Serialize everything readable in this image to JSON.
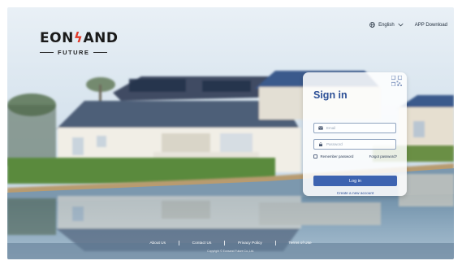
{
  "brand": {
    "logo_left": "EON",
    "logo_right": "AND",
    "tagline": "FUTURE"
  },
  "topbar": {
    "language": "English",
    "app_download": "APP Download"
  },
  "signin": {
    "title": "Sign in",
    "email_placeholder": "Email",
    "password_placeholder": "Password",
    "remember_label": "Remember password",
    "forgot_label": "Forgot password?",
    "login_label": "Log in",
    "create_label": "Create a new account"
  },
  "footer": {
    "links": [
      "About Us",
      "Contact Us",
      "Privacy Policy",
      "Terms of Use"
    ],
    "copyright": "Copyright © Eonsand Future Co.,Ltd."
  },
  "colors": {
    "accent": "#3d63b0",
    "title": "#2c4f96",
    "brand_bolt": "#e23a2a"
  },
  "icons": [
    "globe-icon",
    "chevron-down-icon",
    "qr-code-icon",
    "email-icon",
    "lock-icon",
    "checkbox-icon"
  ]
}
